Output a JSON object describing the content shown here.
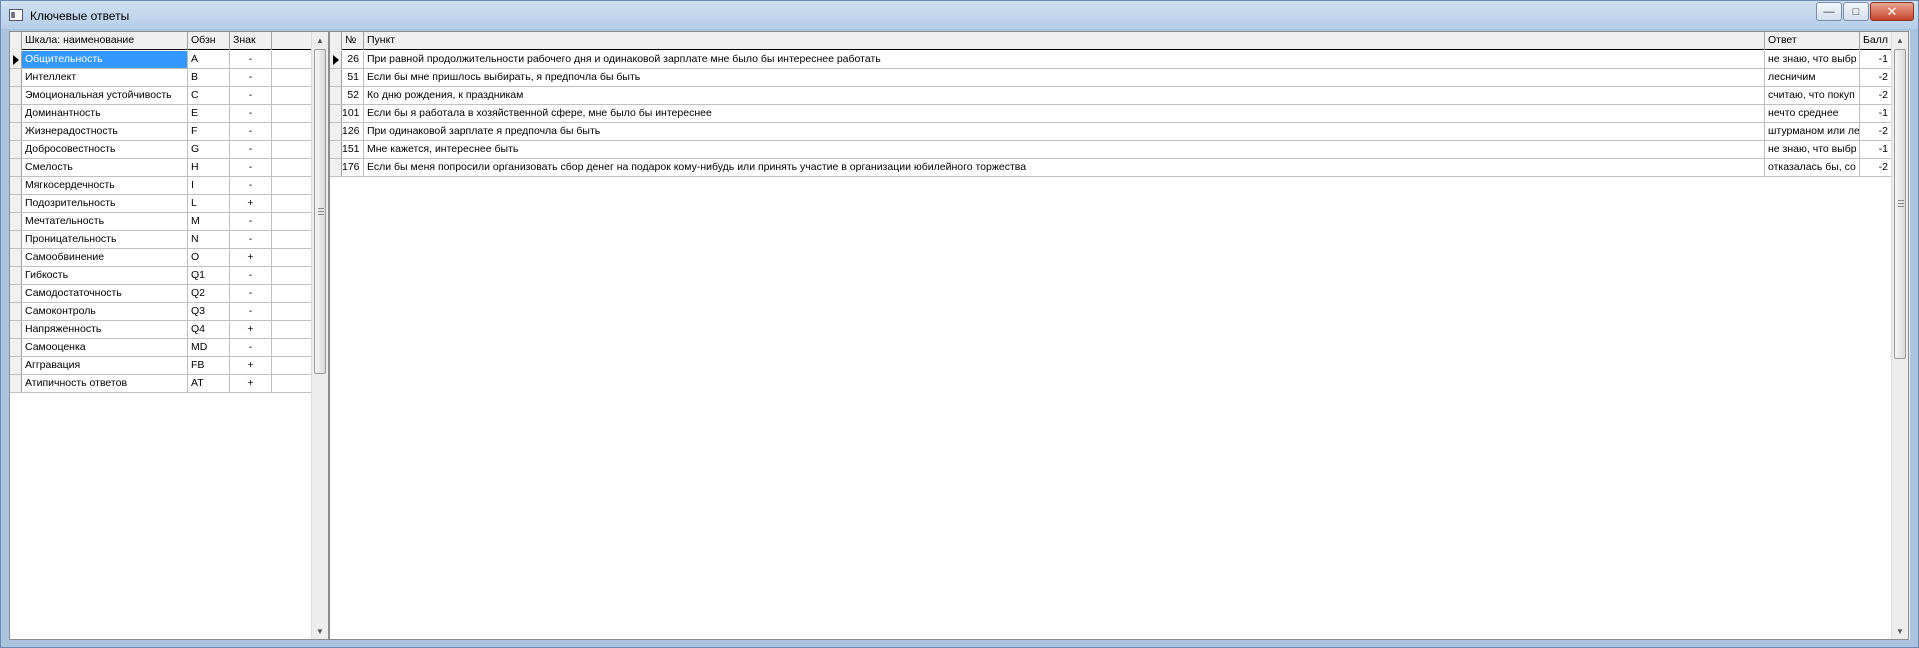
{
  "window": {
    "title": "Ключевые ответы",
    "minimize": "—",
    "maximize": "□",
    "close": "✕"
  },
  "scales": {
    "headers": {
      "name": "Шкала: наименование",
      "code": "Обзн",
      "sign": "Знак"
    },
    "rows": [
      {
        "name": "Общительность",
        "code": "A",
        "sign": "-"
      },
      {
        "name": "Интеллект",
        "code": "B",
        "sign": "-"
      },
      {
        "name": "Эмоциональная устойчивость",
        "code": "C",
        "sign": "-"
      },
      {
        "name": "Доминантность",
        "code": "E",
        "sign": "-"
      },
      {
        "name": "Жизнерадостность",
        "code": "F",
        "sign": "-"
      },
      {
        "name": "Добросовестность",
        "code": "G",
        "sign": "-"
      },
      {
        "name": "Смелость",
        "code": "H",
        "sign": "-"
      },
      {
        "name": "Мягкосердечность",
        "code": "I",
        "sign": "-"
      },
      {
        "name": "Подозрительность",
        "code": "L",
        "sign": "+"
      },
      {
        "name": "Мечтательность",
        "code": "M",
        "sign": "-"
      },
      {
        "name": "Проницательность",
        "code": "N",
        "sign": "-"
      },
      {
        "name": "Самообвинение",
        "code": "O",
        "sign": "+"
      },
      {
        "name": "Гибкость",
        "code": "Q1",
        "sign": "-"
      },
      {
        "name": "Самодостаточность",
        "code": "Q2",
        "sign": "-"
      },
      {
        "name": "Самоконтроль",
        "code": "Q3",
        "sign": "-"
      },
      {
        "name": "Напряженность",
        "code": "Q4",
        "sign": "+"
      },
      {
        "name": "Самооценка",
        "code": "MD",
        "sign": "-"
      },
      {
        "name": "Аггравация",
        "code": "FB",
        "sign": "+"
      },
      {
        "name": "Атипичность ответов",
        "code": "AT",
        "sign": "+"
      }
    ]
  },
  "items": {
    "headers": {
      "num": "№",
      "item": "Пункт",
      "answer": "Ответ",
      "score": "Балл"
    },
    "rows": [
      {
        "num": "26",
        "item": "При равной продолжительности рабочего дня и одинаковой зарплате мне было бы интереснее работать",
        "answer": "не знаю, что выбр",
        "score": "-1"
      },
      {
        "num": "51",
        "item": "Если бы мне пришлось выбирать, я предпочла бы быть",
        "answer": "лесничим",
        "score": "-2"
      },
      {
        "num": "52",
        "item": "Ко дню рождения, к праздникам",
        "answer": "считаю, что покуп",
        "score": "-2"
      },
      {
        "num": "101",
        "item": "Если бы я работала в хозяйственной сфере, мне было бы интереснее",
        "answer": "нечто среднее",
        "score": "-1"
      },
      {
        "num": "126",
        "item": "При одинаковой зарплате я предпочла бы быть",
        "answer": "штурманом или ле",
        "score": "-2"
      },
      {
        "num": "151",
        "item": "Мне кажется, интереснее быть",
        "answer": "не знаю, что выбр",
        "score": "-1"
      },
      {
        "num": "176",
        "item": "Если бы меня попросили организовать сбор денег на подарок кому-нибудь или принять участие в организации юбилейного торжества",
        "answer": "отказалась бы, со",
        "score": "-2"
      }
    ]
  }
}
